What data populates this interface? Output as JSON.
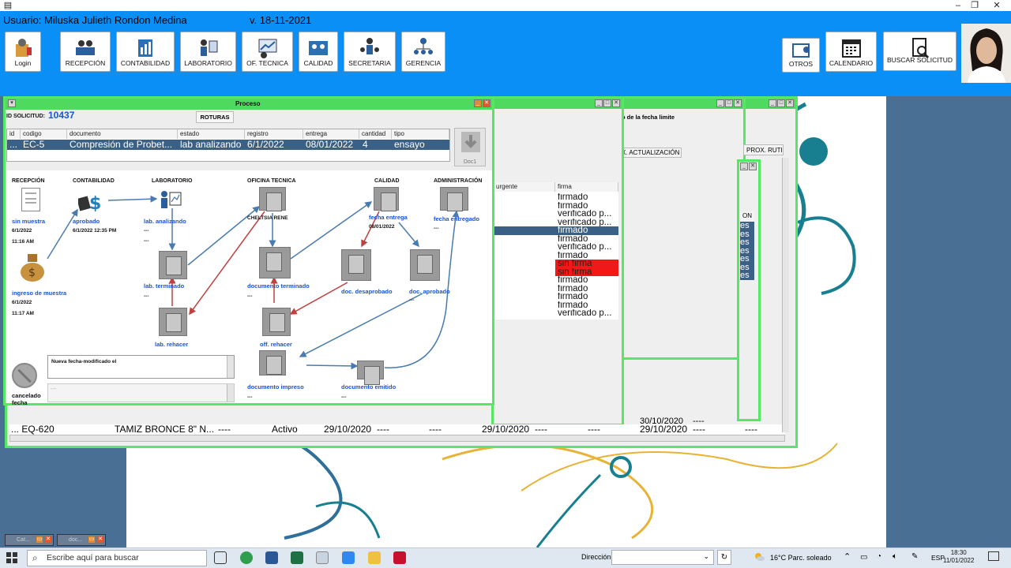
{
  "header": {
    "user": "Usuario: Miluska Julieth  Rondon Medina",
    "version": "v. 18-11-2021",
    "buttons": {
      "login": "Login",
      "recepcion": "RECEPCIÓN",
      "contabilidad": "CONTABILIDAD",
      "laboratorio": "LABORATORIO",
      "of_tecnica": "OF. TECNICA",
      "calidad": "CALIDAD",
      "secretaria": "SECRETARIA",
      "gerencia": "GERENCIA",
      "otros": "OTROS",
      "calendario": "CALENDARIO",
      "buscar": "BUSCAR SOLICITUD"
    }
  },
  "process": {
    "title": "Proceso",
    "id_label": "ID SOLICITUD:",
    "id_value": "10437",
    "roturas_button": "ROTURAS",
    "doc_button": "Doc1",
    "columns": [
      "id",
      "codigo",
      "documento",
      "estado",
      "registro",
      "entrega",
      "cantidad",
      "tipo"
    ],
    "row": [
      "...",
      "EC-5",
      "Compresión de Probet...",
      "lab analizando",
      "6/1/2022",
      "08/01/2022",
      "4",
      "ensayo"
    ],
    "stages": {
      "recepcion": "RECEPCIÓN",
      "contabilidad": "CONTABILIDAD",
      "laboratorio": "LABORATORIO",
      "oficina": "OFICINA TECNICA",
      "calidad": "CALIDAD",
      "administracion": "ADMINISTRACIÓN"
    },
    "nodes": {
      "sin_muestra": "sin muestra",
      "sin_muestra_date": "6/1/2022",
      "sin_muestra_time": "11:16 AM",
      "ingreso": "ingreso de muestra",
      "ingreso_date": "6/1/2022",
      "ingreso_time": "11:17 AM",
      "aprobado": "aprobado",
      "aprobado_date": "6/1/2022 12:35 PM",
      "lab_analizando": "lab. analizando",
      "dash1": "---",
      "dash2": "---",
      "lab_terminado": "lab. terminado",
      "lab_terminado_dash": "---",
      "lab_rehacer": "lab. rehacer",
      "oficina_user": "CHELTSIA RENE",
      "doc_terminado": "documento terminado",
      "doc_terminado_dash": "---",
      "off_rehacer": "off. rehacer",
      "doc_impreso": "documento impreso",
      "doc_impreso_dash": "---",
      "doc_emitido": "documento emitido",
      "doc_emitido_dash": "---",
      "fecha_entrega": "fecha entrega",
      "fecha_entrega_date": "08/01/2022",
      "doc_desaprobado": "doc. desaprobado",
      "doc_aprobado": "doc. aprobado",
      "doc_aprobado_dash": "---",
      "fecha_entregado": "fecha entregado",
      "fecha_entregado_dash": "---",
      "cancelado": "cancelado",
      "cancelado_2": "fecha"
    },
    "note_text": "Nueva fecha-modificado el",
    "note2_text": "---"
  },
  "bg_windows": {
    "fecha_limite": "o de la fecha limite",
    "actualizacion": "X. ACTUALIZACIÓN",
    "prox_rutina": "PROX. RUTI",
    "col_urgente": "urgente",
    "col_firma": "firma",
    "col_on": "ON",
    "firma_rows": [
      "firmado",
      "firmado",
      "verificado p...",
      "verificado p...",
      "firmado",
      "firmado",
      "verificado p...",
      "firmado",
      "sin firma",
      "sin firma",
      "firmado",
      "firmado",
      "firmado",
      "firmado",
      "verificado p..."
    ],
    "es_rows": [
      "es",
      "es",
      "es",
      "es",
      "es",
      "es",
      "es"
    ],
    "bottom_row": [
      "... EQ-620",
      "TAMIZ BRONCE 8\" N...",
      "----",
      "Activo",
      "29/10/2020",
      "----",
      "----",
      "29/10/2020",
      "----",
      "----",
      "29/10/2020",
      "----",
      "----"
    ],
    "bottom_row_prev": "30/10/2020",
    "bottom_row_prev_dash": "----"
  },
  "minimized": [
    "Cat...",
    "doc..."
  ],
  "taskbar": {
    "search_placeholder": "Escribe aquí para buscar",
    "direccion": "Dirección",
    "weather": "16°C  Parc. soleado",
    "lang": "ESP",
    "time": "18:30",
    "date": "11/01/2022"
  }
}
